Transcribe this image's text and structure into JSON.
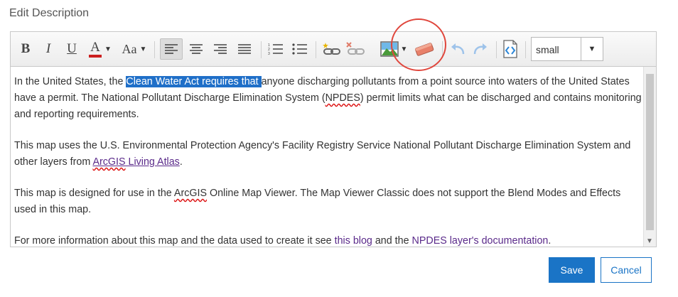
{
  "dialog": {
    "title": "Edit Description"
  },
  "toolbar": {
    "bold_label": "B",
    "italic_label": "I",
    "underline_label": "U",
    "font_color_label": "A",
    "font_size_glyph": "Aa",
    "font_select_value": "small",
    "icons": [
      "bold-icon",
      "italic-icon",
      "underline-icon",
      "font-color-icon",
      "font-size-icon",
      "align-left-icon",
      "align-center-icon",
      "align-right-icon",
      "align-justify-icon",
      "ordered-list-icon",
      "unordered-list-icon",
      "link-icon",
      "unlink-icon",
      "image-icon",
      "eraser-icon",
      "undo-icon",
      "redo-icon",
      "html-source-icon"
    ]
  },
  "content": {
    "p1": {
      "before": "In the United States, the ",
      "highlighted": "Clean Water Act requires that ",
      "after1": "anyone discharging pollutants from a point source into waters of the United States have a permit. The National Pollutant Discharge Elimination System (",
      "npdes": "NPDES",
      "after2": ") permit limits what can be discharged and contains monitoring and reporting requirements."
    },
    "p2": {
      "text": "This map uses the U.S. Environmental Protection Agency's Facility Registry Service National Pollutant Discharge Elimination System and other layers from ",
      "link_arcgis": "ArcGIS",
      "link_rest": " Living Atlas",
      "end": "."
    },
    "p3": {
      "before": "This map is designed for use in the ",
      "arcgis": "ArcGIS",
      "after": " Online Map Viewer. The Map Viewer Classic does not support the Blend Modes and Effects used in this map."
    },
    "p4": {
      "before": "For more information about this map and the data used to create it see ",
      "link_blog": "this blog",
      "middle": " and the ",
      "link_doc": "NPDES layer's documentation",
      "end": "."
    }
  },
  "buttons": {
    "save": "Save",
    "cancel": "Cancel"
  },
  "colors": {
    "highlight": "#1f6fc8",
    "save_bg": "#1a74c6",
    "annotation": "#e0463c"
  }
}
